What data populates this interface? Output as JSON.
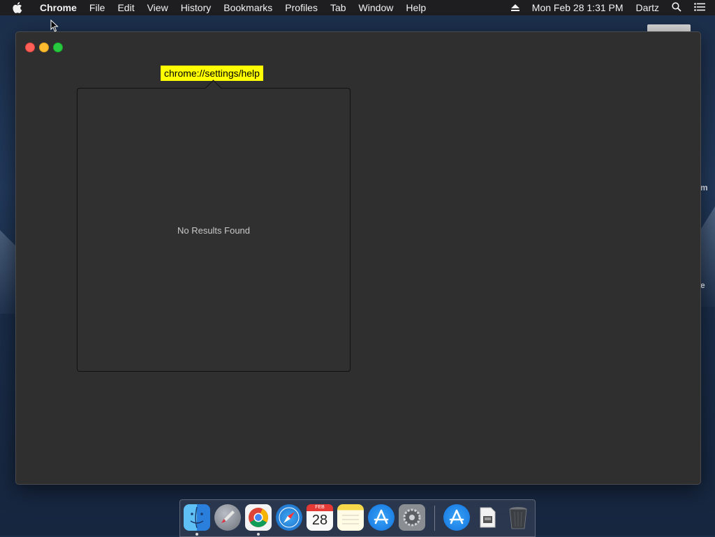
{
  "menubar": {
    "app_name": "Chrome",
    "items": [
      "File",
      "Edit",
      "View",
      "History",
      "Bookmarks",
      "Profiles",
      "Tab",
      "Window",
      "Help"
    ],
    "datetime": "Mon Feb 28  1:31 PM",
    "user": "Dartz"
  },
  "window": {
    "url_tooltip": "chrome://settings/help",
    "popup_message": "No Results Found"
  },
  "desktop": {
    "partial_label_1": "m",
    "partial_label_2": "e"
  },
  "dock": {
    "items": [
      {
        "name": "Finder",
        "icon": "finder-icon"
      },
      {
        "name": "Launchpad",
        "icon": "launchpad-icon"
      },
      {
        "name": "Google Chrome",
        "icon": "chrome-icon"
      },
      {
        "name": "Safari",
        "icon": "safari-icon"
      },
      {
        "name": "Calendar",
        "icon": "calendar-icon",
        "month": "FEB",
        "day": "28"
      },
      {
        "name": "Notes",
        "icon": "notes-icon"
      },
      {
        "name": "App Store",
        "icon": "app-store-icon"
      },
      {
        "name": "System Preferences",
        "icon": "system-preferences-icon"
      },
      {
        "name": "App Store",
        "icon": "app-store-icon"
      },
      {
        "name": "Disk Image",
        "icon": "disk-image-icon"
      },
      {
        "name": "Trash",
        "icon": "trash-icon"
      }
    ]
  },
  "colors": {
    "tooltip_bg": "#ffff00",
    "window_bg": "#2f2f30",
    "close": "#fe5f57",
    "minimize": "#febc2e",
    "maximize": "#28c840"
  }
}
